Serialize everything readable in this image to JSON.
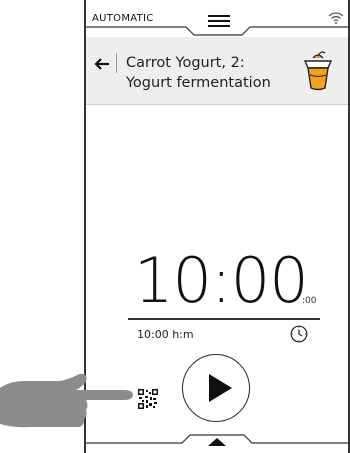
{
  "status_bar": {
    "mode": "AUTOMATIC",
    "menu_icon": "hamburger-menu-icon",
    "wifi_icon": "wifi-icon"
  },
  "header": {
    "back_icon": "arrow-left-icon",
    "title_line1": "Carrot Yogurt, 2:",
    "title_line2": "Yogurt fermentation",
    "recipe_icon": "yogurt-cup-icon"
  },
  "timer": {
    "main": "10:00",
    "seconds": ":00",
    "subtitle": "10:00 h:m",
    "clock_icon": "clock-icon"
  },
  "controls": {
    "play_icon": "play-icon",
    "qr_icon": "qr-code-icon",
    "pull_up_icon": "triangle-up-icon"
  },
  "overlay": {
    "hand_icon": "pointing-hand-icon"
  },
  "colors": {
    "header_bg": "#eeeeee",
    "yogurt_orange": "#f4a21c",
    "hand_gray": "#8c8c8c"
  }
}
